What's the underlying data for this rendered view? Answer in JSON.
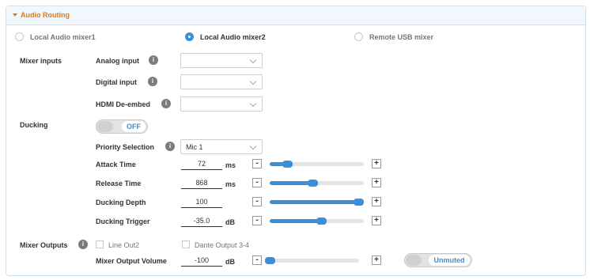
{
  "panel": {
    "title": "Audio Routing"
  },
  "sources": [
    {
      "label": "Local Audio mixer1",
      "selected": false
    },
    {
      "label": "Local Audio mixer2",
      "selected": true
    },
    {
      "label": "Remote USB mixer",
      "selected": false
    }
  ],
  "mixer_inputs": {
    "section_label": "Mixer inputs",
    "analog": {
      "label": "Analog input",
      "value": ""
    },
    "digital": {
      "label": "Digital input",
      "value": ""
    },
    "hdmi": {
      "label": "HDMI De-embed",
      "value": ""
    }
  },
  "ducking": {
    "section_label": "Ducking",
    "toggle_label": "OFF",
    "priority": {
      "label": "Priority Selection",
      "value": "Mic 1"
    },
    "attack": {
      "label": "Attack Time",
      "value": "72",
      "unit": "ms",
      "level": 0.15
    },
    "release": {
      "label": "Release Time",
      "value": "868",
      "unit": "ms",
      "level": 0.45
    },
    "depth": {
      "label": "Ducking Depth",
      "value": "100",
      "unit": "",
      "level": 1.0
    },
    "trigger": {
      "label": "Ducking Trigger",
      "value": "-35.0",
      "unit": "dB",
      "level": 0.56
    }
  },
  "mixer_outputs": {
    "section_label": "Mixer Outputs",
    "line_out": {
      "label": "Line Out2",
      "checked": false
    },
    "dante_out": {
      "label": "Dante Output 3-4",
      "checked": false
    },
    "volume": {
      "label": "Mixer Output Volume",
      "value": "-100",
      "unit": "dB",
      "level": 0.0
    },
    "mute_label": "Unmuted"
  },
  "controls": {
    "minus": "-",
    "plus": "+",
    "info": "i"
  },
  "colors": {
    "accent": "#3b8fd8",
    "title": "#e07a10",
    "header_bg": "#f1f7fc"
  },
  "icons": {
    "caret": "caret-down-icon",
    "info": "info-icon",
    "chevron": "chevron-down-icon"
  }
}
